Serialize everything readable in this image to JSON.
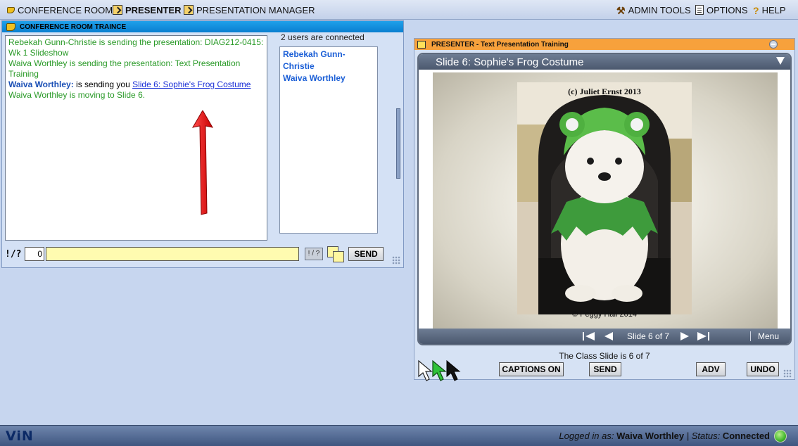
{
  "topbar": {
    "conference_room": "CONFERENCE ROOM",
    "presenter": "PRESENTER",
    "presentation_manager": "PRESENTATION MANAGER",
    "admin_tools": "ADMIN TOOLS",
    "options": "OPTIONS",
    "help": "HELP"
  },
  "chat": {
    "header": "CONFERENCE ROOM TRAINCE",
    "messages": [
      "Rebekah Gunn-Christie is sending the presentation: DIAG212-0415: Wk 1 Slideshow",
      "Waiva Worthley is sending the presentation: Text Presentation Training"
    ],
    "send_line": {
      "name": "Waiva Worthley:",
      "text": " is sending you ",
      "link": "Slide 6: Sophie's Frog Costume"
    },
    "last_message": "Waiva Worthley is moving to Slide 6.",
    "users_count": "2 users are connected",
    "users": [
      "Rebekah Gunn-Christie",
      "Waiva Worthley"
    ],
    "exclaim_label": "!/?",
    "count_value": "0",
    "input_value": "",
    "mini_btn": "! / ?",
    "send_label": "SEND"
  },
  "presenter": {
    "header": "PRESENTER - Text Presentation Training",
    "slide_title": "Slide 6: Sophie's Frog Costume",
    "photo_caption_top": "(c) Juliet Ernst 2013",
    "photo_caption_bottom": "© Peggy Hall 2014",
    "nav_label": "Slide 6 of 7",
    "menu_label": "Menu",
    "class_slide": "The Class Slide is 6 of 7",
    "captions_label": "CAPTIONS ON",
    "send_label": "SEND",
    "adv_label": "ADV",
    "undo_label": "UNDO"
  },
  "statusbar": {
    "logo": "ViN",
    "logged_in_prefix": "Logged in as: ",
    "user": "Waiva Worthley",
    "status_prefix": " | Status: ",
    "status": "Connected"
  },
  "colors": {
    "accent_blue": "#0a7fd0",
    "presenter_orange": "#f7a13c",
    "status_green": "#44b82e",
    "system_text_green": "#2a9a28"
  }
}
